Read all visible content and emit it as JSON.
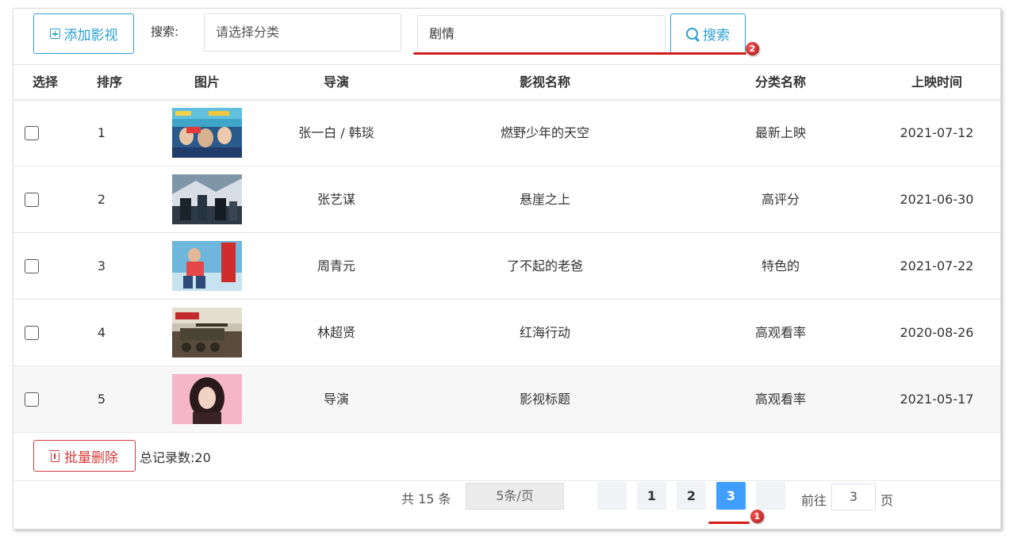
{
  "toolbar": {
    "add_label": "添加影视",
    "search_label": "搜索:",
    "category_placeholder": "请选择分类",
    "keyword_value": "剧情",
    "search_button": "搜索"
  },
  "annotations": {
    "badge1": "1",
    "badge2": "2",
    "accent": "#d21d1d"
  },
  "table": {
    "headers": [
      "选择",
      "排序",
      "图片",
      "导演",
      "影视名称",
      "分类名称",
      "上映时间"
    ],
    "rows": [
      {
        "order": "1",
        "director": "张一白 / 韩琰",
        "title": "燃野少年的天空",
        "category": "最新上映",
        "date": "2021-07-12"
      },
      {
        "order": "2",
        "director": "张艺谋",
        "title": "悬崖之上",
        "category": "高评分",
        "date": "2021-06-30"
      },
      {
        "order": "3",
        "director": "周青元",
        "title": "了不起的老爸",
        "category": "特色的",
        "date": "2021-07-22"
      },
      {
        "order": "4",
        "director": "林超贤",
        "title": "红海行动",
        "category": "高观看率",
        "date": "2020-08-26"
      },
      {
        "order": "5",
        "director": "导演",
        "title": "影视标题",
        "category": "高观看率",
        "date": "2021-05-17"
      }
    ]
  },
  "footer": {
    "batch_delete": "批量删除",
    "total_records": "总记录数:20"
  },
  "pagination": {
    "total_text": "共 15 条",
    "page_size": "5条/页",
    "pages": [
      "1",
      "2",
      "3"
    ],
    "current": "3",
    "goto_label": "前往",
    "goto_value": "3",
    "page_unit": "页",
    "active_color": "#409eff"
  }
}
